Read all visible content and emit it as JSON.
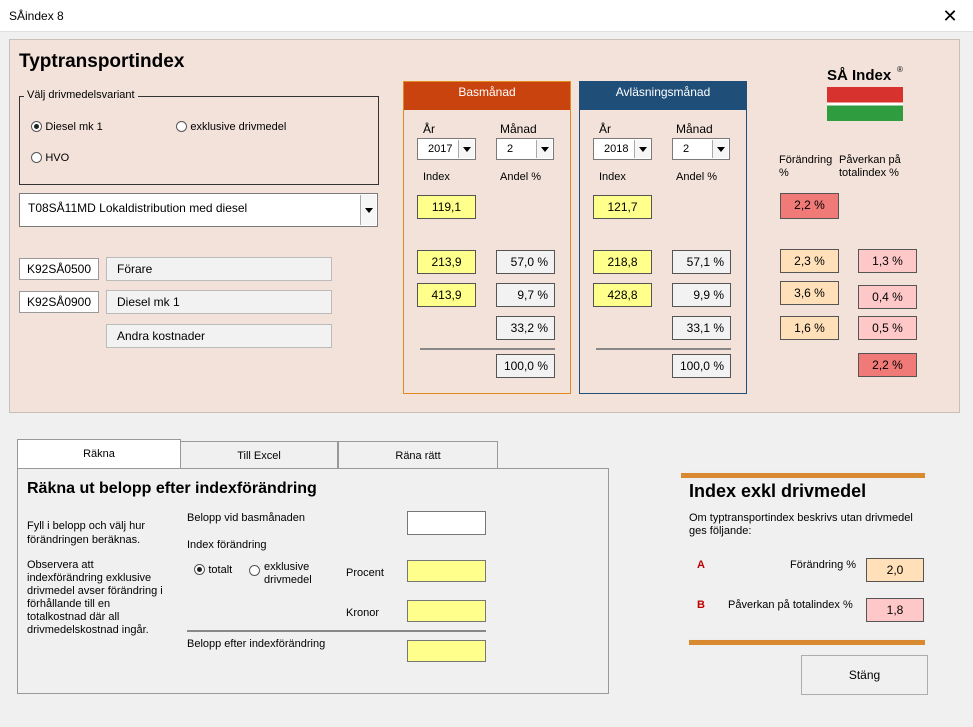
{
  "window": {
    "title": "SÅindex 8",
    "close_label": "✕"
  },
  "main": {
    "heading": "Typtransportindex",
    "variant_group": {
      "label": "Välj drivmedelsvariant",
      "options": [
        "Diesel mk 1",
        "exklusive drivmedel",
        "HVO"
      ],
      "selected": "Diesel mk 1"
    },
    "category_select": "T08SÅ11MD Lokaldistribution med diesel",
    "rows": [
      {
        "code": "K92SÅ0500",
        "name": "Förare"
      },
      {
        "code": "K92SÅ0900",
        "name": "Diesel mk 1"
      },
      {
        "code": "",
        "name": "Andra kostnader"
      }
    ],
    "logo_text": "SÅ Index",
    "logo_mark": "®"
  },
  "bas": {
    "header": "Basmånad",
    "header_color": "#c9430f",
    "year_label": "År",
    "month_label": "Månad",
    "year": "2017",
    "month": "2",
    "index_label": "Index",
    "share_label": "Andel %",
    "index": "119,1",
    "values": [
      "213,9",
      "413,9"
    ],
    "shares": [
      "57,0 %",
      "9,7 %",
      "33,2 %"
    ],
    "total_share": "100,0 %"
  },
  "avl": {
    "header": "Avläsningsmånad",
    "header_color": "#1f4e79",
    "year_label": "År",
    "month_label": "Månad",
    "year": "2018",
    "month": "2",
    "index_label": "Index",
    "share_label": "Andel %",
    "index": "121,7",
    "values": [
      "218,8",
      "428,8"
    ],
    "shares": [
      "57,1 %",
      "9,9 %",
      "33,1 %"
    ],
    "total_share": "100,0 %"
  },
  "change": {
    "change_label": "Förändring %",
    "impact_label": "Påverkan på totalindex %",
    "total_change": "2,2 %",
    "changes": [
      "2,3 %",
      "3,6 %",
      "1,6 %"
    ],
    "impacts": [
      "1,3 %",
      "0,4 %",
      "0,5 %"
    ],
    "total_impact": "2,2 %"
  },
  "tabs": [
    {
      "label": "Räkna"
    },
    {
      "label": "Till Excel"
    },
    {
      "label": "Räna rätt"
    }
  ],
  "calc": {
    "heading": "Räkna ut belopp efter indexförändring",
    "help1": "Fyll i belopp och välj hur förändringen beräknas.",
    "help2": "Observera att indexförändring exklusive drivmedel avser förändring i förhållande till en totalkostnad där all drivmedelskostnad ingår.",
    "amount_base_label": "Belopp vid basmånaden",
    "index_change_label": "Index förändring",
    "opt_total": "totalt",
    "opt_excl": "exklusive drivmedel",
    "percent_label": "Procent",
    "kronor_label": "Kronor",
    "amount_after_label": "Belopp efter indexförändring"
  },
  "excl": {
    "heading": "Index exkl drivmedel",
    "desc": "Om typtransportindex beskrivs utan drivmedel ges följande:",
    "a_letter": "A",
    "a_label": "Förändring %",
    "a_value": "2,0",
    "b_letter": "B",
    "b_label": "Påverkan på totalindex %",
    "b_value": "1,8"
  },
  "close_button": "Stäng"
}
